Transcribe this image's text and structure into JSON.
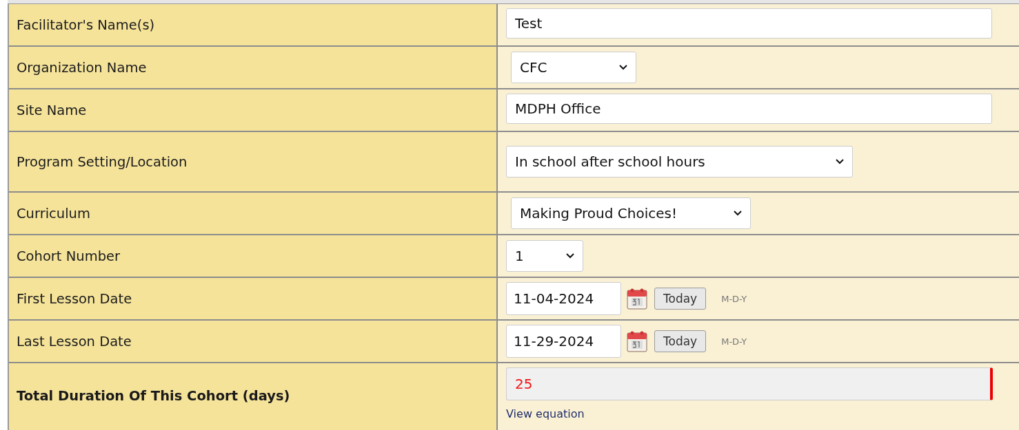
{
  "rows": [
    {
      "label": "Facilitator's Name(s)",
      "emphasis": false,
      "kind": "text",
      "value": "Test"
    },
    {
      "label": "Organization Name",
      "emphasis": false,
      "kind": "select",
      "value": "CFC"
    },
    {
      "label": "Site Name",
      "emphasis": false,
      "kind": "text",
      "value": "MDPH Office"
    },
    {
      "label": "Program Setting/Location",
      "emphasis": false,
      "kind": "select",
      "value": "In school after school hours"
    },
    {
      "label": "Curriculum",
      "emphasis": false,
      "kind": "select",
      "value": "Making Proud Choices!"
    },
    {
      "label": "Cohort Number",
      "emphasis": false,
      "kind": "select",
      "value": "1"
    },
    {
      "label": "First Lesson Date",
      "emphasis": false,
      "kind": "date",
      "value": "11-04-2024",
      "button": "Today",
      "format": "M-D-Y"
    },
    {
      "label": "Last Lesson Date",
      "emphasis": false,
      "kind": "date",
      "value": "11-29-2024",
      "button": "Today",
      "format": "M-D-Y"
    },
    {
      "label": "Total Duration Of This Cohort (days)",
      "emphasis": true,
      "kind": "computed",
      "value": "25",
      "link": "View equation"
    }
  ]
}
